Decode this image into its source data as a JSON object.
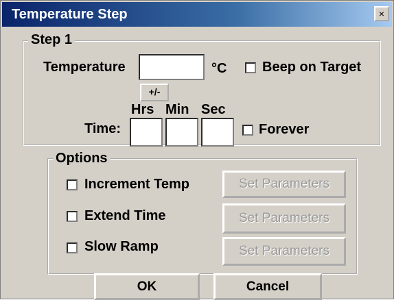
{
  "window": {
    "title": "Temperature Step",
    "close_label": "×"
  },
  "step1": {
    "legend": "Step 1",
    "temperature_label": "Temperature",
    "temperature_value": "",
    "unit": "°C",
    "beep_label": "Beep on Target",
    "sign_button": "+/-",
    "time_label": "Time:",
    "hrs_label": "Hrs",
    "min_label": "Min",
    "sec_label": "Sec",
    "hrs_value": "",
    "min_value": "",
    "sec_value": "",
    "forever_label": "Forever"
  },
  "options": {
    "legend": "Options",
    "rows": [
      {
        "label": "Increment Temp",
        "button": "Set Parameters",
        "checked": false
      },
      {
        "label": "Extend Time",
        "button": "Set Parameters",
        "checked": false
      },
      {
        "label": "Slow Ramp",
        "button": "Set Parameters",
        "checked": false
      }
    ]
  },
  "footer": {
    "ok_label": "OK",
    "cancel_label": "Cancel"
  }
}
